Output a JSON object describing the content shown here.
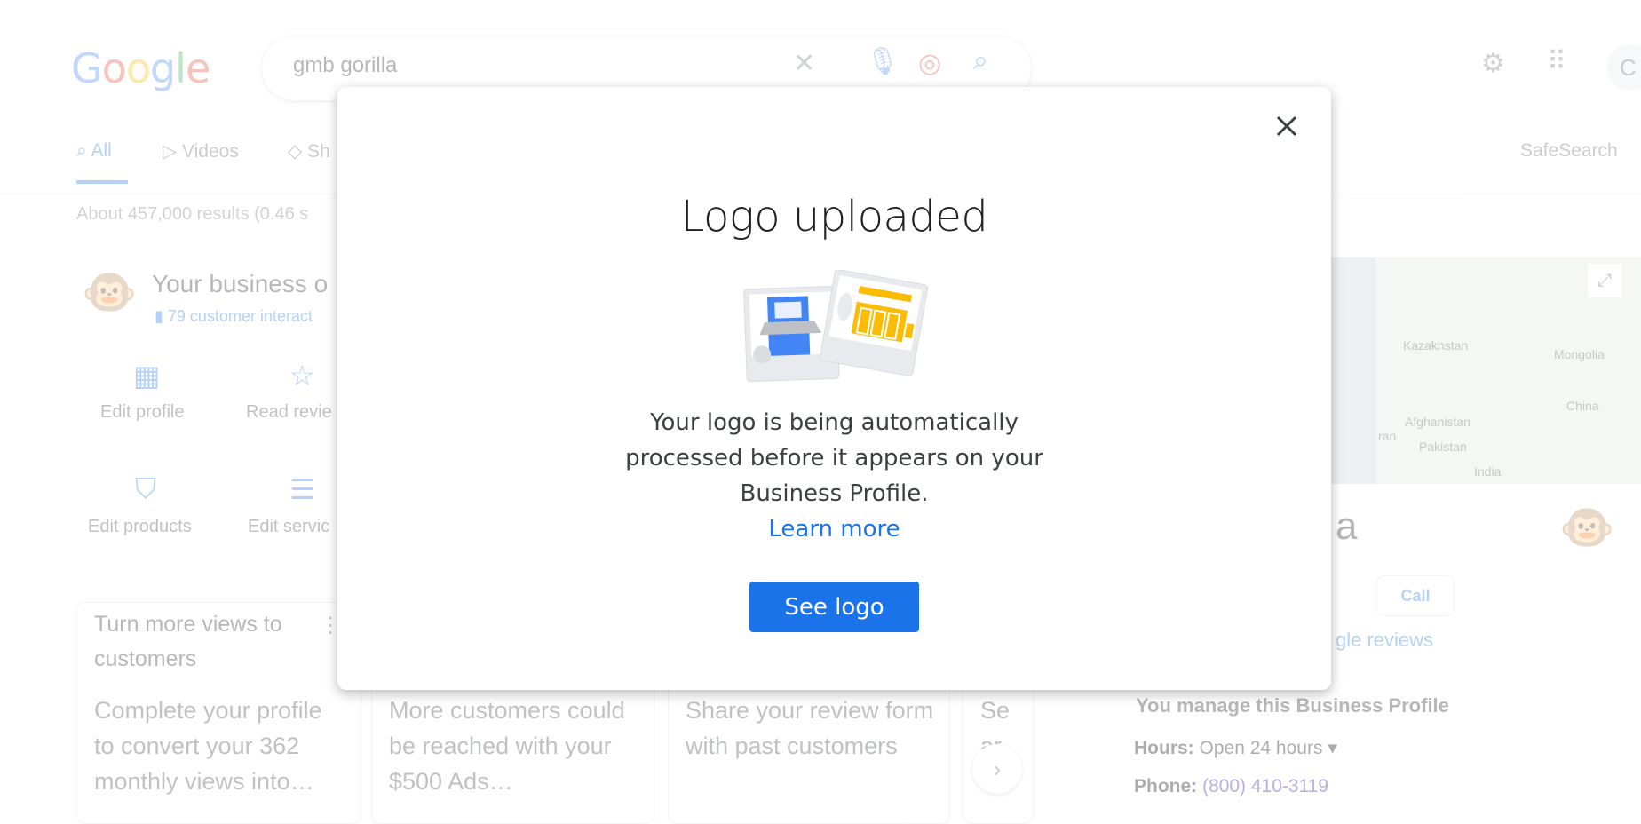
{
  "search": {
    "logo": "Google",
    "query": "gmb gorilla",
    "icons": [
      "close-icon",
      "microphone-icon",
      "lens-icon",
      "search-icon"
    ]
  },
  "header": {
    "avatar_letter": "C",
    "icons": [
      "gear-icon",
      "apps-grid-icon"
    ]
  },
  "tabs": [
    {
      "label": "All",
      "icon": "search-icon",
      "active": true
    },
    {
      "label": "Videos",
      "icon": "play-icon"
    },
    {
      "label": "Sh",
      "icon": "tag-icon"
    }
  ],
  "safesearch": "SafeSearch",
  "results_stats": "About 457,000 results (0.46 s",
  "business": {
    "title": "Your business o",
    "interactions": "79 customer interact",
    "actions": [
      {
        "label": "Edit profile",
        "icon": "storefront-icon"
      },
      {
        "label": "Read revie",
        "icon": "review-star-icon"
      },
      {
        "label": "Edit products",
        "icon": "shopping-bag-icon"
      },
      {
        "label": "Edit servic",
        "icon": "list-icon"
      }
    ],
    "cards": [
      {
        "title": "Turn more views to customers",
        "body": "Complete your profile to convert your 362 monthly views into…"
      },
      {
        "title": "",
        "body": "More customers could be reached with your $500 Ads…"
      },
      {
        "title": "",
        "body": "Share your review form with past customers"
      },
      {
        "title": "",
        "body": "Se ar"
      }
    ]
  },
  "knowledge_panel": {
    "map_labels": [
      "Kazakhstan",
      "Mongolia",
      "China",
      "Afghanistan",
      "Pakistan",
      "India",
      "ran"
    ],
    "name_fragment": "a",
    "call_label": "Call",
    "reviews_link": "gle reviews",
    "manage_text": "You manage this Business Profile",
    "hours_label": "Hours:",
    "hours_value": "Open 24 hours",
    "phone_label": "Phone:",
    "phone_value": "(800) 410-3119"
  },
  "dialog": {
    "title": "Logo uploaded",
    "body_lines": [
      "Your logo is being automatically",
      "processed before it appears on your",
      "Business Profile."
    ],
    "learn_more": "Learn more",
    "see_logo": "See logo",
    "accent": "#1a73e8"
  }
}
